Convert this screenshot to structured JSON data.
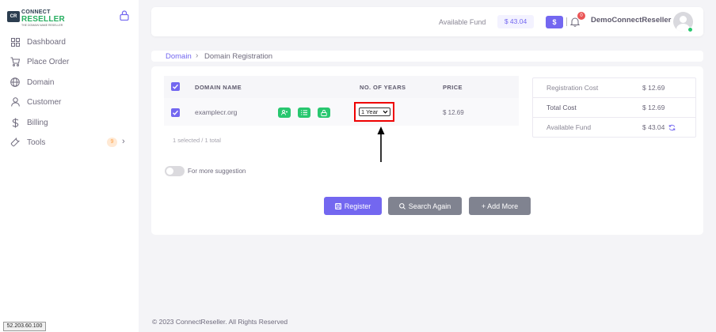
{
  "brand": {
    "line1": "CONNECT",
    "line2": "RESELLER",
    "tagline": "THE DOMAIN NAME RESELLER",
    "mark": "CR"
  },
  "sidebar": {
    "items": [
      {
        "label": "Dashboard",
        "icon": "grid-icon"
      },
      {
        "label": "Place Order",
        "icon": "cart-icon"
      },
      {
        "label": "Domain",
        "icon": "globe-icon"
      },
      {
        "label": "Customer",
        "icon": "user-icon"
      },
      {
        "label": "Billing",
        "icon": "dollar-icon"
      },
      {
        "label": "Tools",
        "icon": "wrench-icon",
        "badge": "9"
      }
    ]
  },
  "header": {
    "available_fund_label": "Available Fund",
    "available_fund_value": "$ 43.04",
    "fund_button": "$",
    "notification_count": "0",
    "username": "DemoConnectReseller"
  },
  "breadcrumb": {
    "link": "Domain",
    "separator": "›",
    "current": "Domain Registration"
  },
  "table": {
    "headers": {
      "domain": "DOMAIN NAME",
      "years": "NO. OF YEARS",
      "price": "PRICE"
    },
    "rows": [
      {
        "domain": "examplecr.org",
        "years": "1 Year",
        "price": "$ 12.69"
      }
    ],
    "selected_count": "1 selected / 1 total"
  },
  "suggestion_toggle": {
    "label": "For more suggestion",
    "enabled": false
  },
  "buttons": {
    "register": "Register",
    "search_again": "Search Again",
    "add_more": "+ Add More"
  },
  "summary": [
    {
      "label": "Registration Cost",
      "value": "$ 12.69"
    },
    {
      "label": "Total Cost",
      "value": "$ 12.69"
    },
    {
      "label": "Available Fund",
      "value": "$ 43.04"
    }
  ],
  "footer": "© 2023 ConnectReseller. All Rights Reserved",
  "ip_badge": "52.203.60.100",
  "colors": {
    "accent": "#7367f0",
    "success": "#28c76f",
    "danger": "#ea5455",
    "highlight": "#ee0000"
  }
}
